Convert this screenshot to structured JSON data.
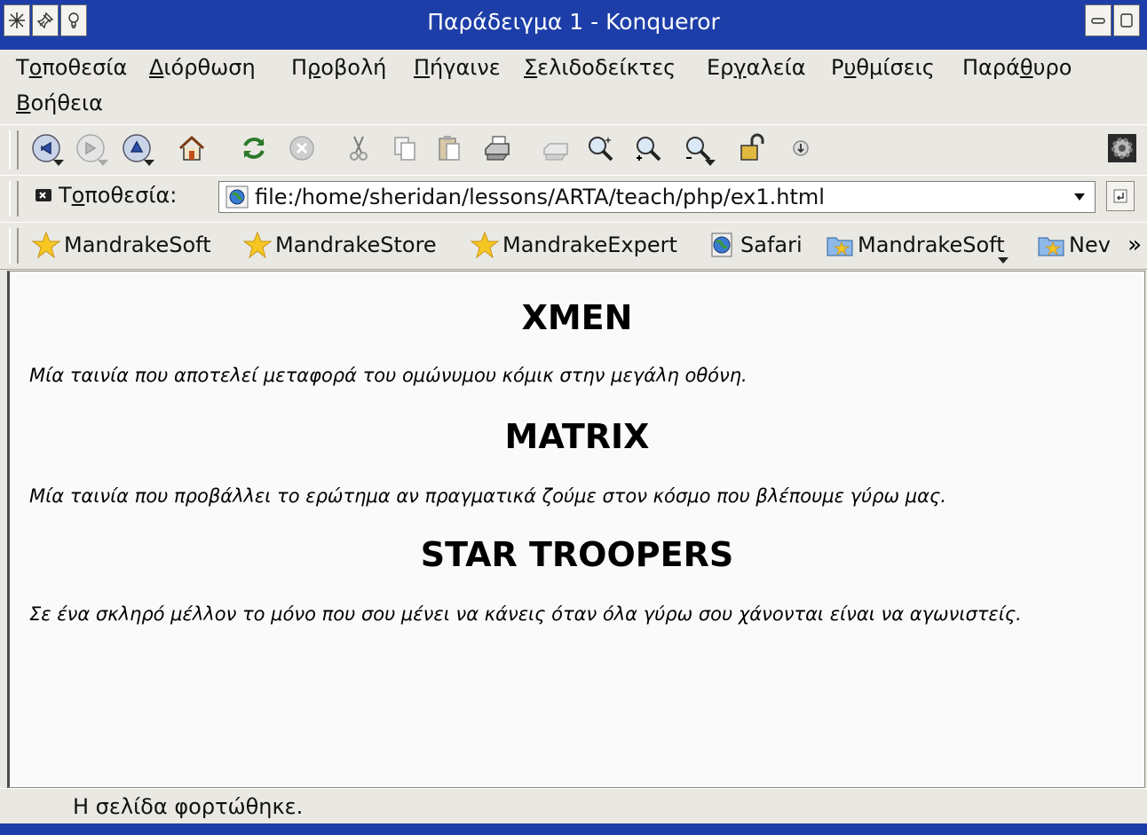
{
  "window": {
    "title": "Παράδειγμα 1 - Konqueror"
  },
  "menubar": {
    "items": [
      {
        "pre": "Τ",
        "key": "ο",
        "post": "ποθεσία"
      },
      {
        "pre": "",
        "key": "Δ",
        "post": "ιόρθωση"
      },
      {
        "pre": "Π",
        "key": "ρ",
        "post": "οβολή"
      },
      {
        "pre": "",
        "key": "Π",
        "post": "ήγαινε"
      },
      {
        "pre": "",
        "key": "Σ",
        "post": "ελιδοδείκτες"
      },
      {
        "pre": "Ερ",
        "key": "γ",
        "post": "αλεία"
      },
      {
        "pre": "Ρ",
        "key": "υ",
        "post": "θμίσεις"
      },
      {
        "pre": "Παρά",
        "key": "θ",
        "post": "υρο"
      },
      {
        "pre": "",
        "key": "Β",
        "post": "οήθεια"
      }
    ]
  },
  "toolbar": {
    "icons": [
      "back-icon",
      "forward-icon",
      "up-icon",
      "home-icon",
      "reload-icon",
      "stop-icon",
      "cut-icon",
      "copy-icon",
      "paste-icon",
      "print-icon",
      "print-frame-icon",
      "find-icon",
      "zoom-in-icon",
      "zoom-out-icon",
      "security-lock-icon",
      "download-icon",
      "konqueror-gear-icon"
    ]
  },
  "location": {
    "label_pre": "Τ",
    "label_key": "ο",
    "label_post": "ποθεσία:",
    "url": "file:/home/sheridan/lessons/ARTA/teach/php/ex1.html"
  },
  "bookmarks": {
    "items": [
      {
        "label": "MandrakeSoft",
        "icon": "star-bookmark-icon"
      },
      {
        "label": "MandrakeStore",
        "icon": "star-bookmark-icon"
      },
      {
        "label": "MandrakeExpert",
        "icon": "star-bookmark-icon"
      },
      {
        "label": "Safari",
        "icon": "globe-bookmark-icon"
      },
      {
        "label": "MandrakeSoft",
        "icon": "bookmark-folder-icon"
      },
      {
        "label": "Nev",
        "icon": "bookmark-folder-icon"
      }
    ],
    "more": "»"
  },
  "page": {
    "sections": [
      {
        "heading": "XMEN",
        "text": "Μία ταινία που αποτελεί μεταφορά του ομώνυμου κόμικ στην μεγάλη οθόνη."
      },
      {
        "heading": "MATRIX",
        "text": "Μία ταινία που προβάλλει το ερώτημα αν πραγματικά ζούμε στον κόσμο που βλέπουμε γύρω μας."
      },
      {
        "heading": "STAR TROOPERS",
        "text": "Σε ένα σκληρό μέλλον το μόνο που σου μένει να κάνεις όταν όλα γύρω σου χάνονται είναι να αγωνιστείς."
      }
    ]
  },
  "status": {
    "text": "Η σελίδα φορτώθηκε."
  },
  "colors": {
    "titlebar": "#1d3ea8",
    "chrome": "#eae8e2",
    "page_bg": "#fafafa"
  }
}
